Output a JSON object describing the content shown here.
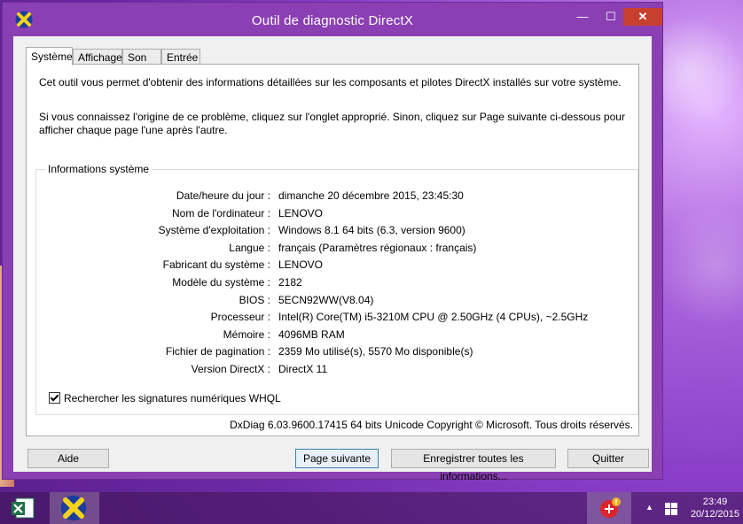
{
  "window": {
    "title": "Outil de diagnostic DirectX",
    "minimize": "—",
    "maximize": "☐",
    "close": "✕"
  },
  "tabs": [
    {
      "label": "Système",
      "active": true
    },
    {
      "label": "Affichage",
      "active": false
    },
    {
      "label": "Son",
      "active": false
    },
    {
      "label": "Entrée",
      "active": false
    }
  ],
  "intro": {
    "line1": "Cet outil vous permet d'obtenir des informations détaillées sur les composants et pilotes DirectX installés sur votre système.",
    "line2": "Si vous connaissez l'origine de ce problème, cliquez sur l'onglet approprié. Sinon, cliquez sur Page suivante ci-dessous pour afficher chaque page l'une après l'autre."
  },
  "system_info": {
    "label": "Informations système",
    "rows": [
      {
        "key": "Date/heure du jour :",
        "value": "dimanche 20 décembre 2015, 23:45:30"
      },
      {
        "key": "Nom de l'ordinateur :",
        "value": "LENOVO"
      },
      {
        "key": "Système d'exploitation :",
        "value": "Windows 8.1 64 bits (6.3, version 9600)"
      },
      {
        "key": "Langue :",
        "value": "français (Paramètres régionaux : français)"
      },
      {
        "key": "Fabricant du système :",
        "value": "LENOVO"
      },
      {
        "key": "Modèle du système :",
        "value": "2182"
      },
      {
        "key": "BIOS :",
        "value": "5ECN92WW(V8.04)"
      },
      {
        "key": "Processeur :",
        "value": "Intel(R) Core(TM) i5-3210M CPU @ 2.50GHz (4 CPUs), ~2.5GHz"
      },
      {
        "key": "Mémoire :",
        "value": "4096MB RAM"
      },
      {
        "key": "Fichier de pagination :",
        "value": "2359 Mo utilisé(s), 5570 Mo disponible(s)"
      },
      {
        "key": "Version DirectX :",
        "value": "DirectX 11"
      }
    ],
    "checkbox_label": "Rechercher les signatures numériques WHQL",
    "checkbox_checked": true
  },
  "copyright": "DxDiag 6.03.9600.17415 64 bits Unicode Copyright © Microsoft. Tous droits réservés.",
  "buttons": {
    "help": "Aide",
    "next_page": "Page suivante",
    "save_all": "Enregistrer toutes les informations...",
    "quit": "Quitter"
  },
  "taskbar": {
    "time": "23:49",
    "date": "20/12/2015",
    "tray_chevron": "▲"
  },
  "colors": {
    "window_frame": "#8a3fb3",
    "close_button": "#c7402f",
    "client_bg": "#f0f0f0",
    "dx_icon_yellow": "#f2d21c",
    "dx_icon_blue": "#1c3d9e"
  }
}
